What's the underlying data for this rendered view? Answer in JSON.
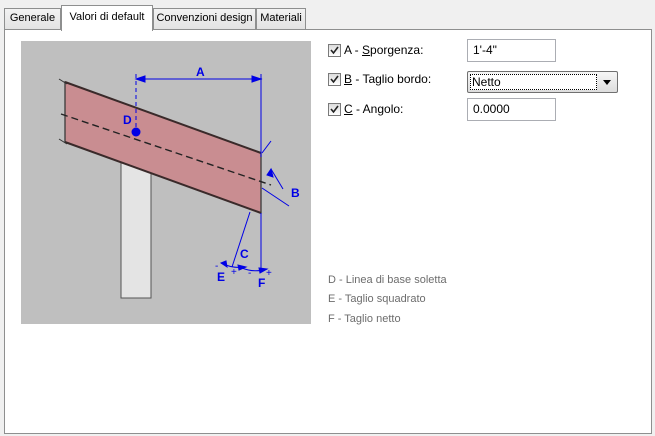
{
  "tabs": [
    {
      "label": "Generale"
    },
    {
      "label": "Valori di default"
    },
    {
      "label": "Convenzioni design"
    },
    {
      "label": "Materiali"
    }
  ],
  "active_tab": "Valori di default",
  "diagram": {
    "labels": {
      "a": "A",
      "b": "B",
      "c": "C",
      "d": "D",
      "e": "E",
      "f": "F",
      "plus": "+",
      "minus": "-"
    }
  },
  "fields": {
    "sporgenza": {
      "label_prefix": "A - ",
      "label_key": "S",
      "label_rest": "porgenza:",
      "checked": true,
      "value": "1'-4\""
    },
    "taglio_bordo": {
      "label_key": "B",
      "label_rest": " - Taglio bordo:",
      "checked": true,
      "value": "Netto"
    },
    "angolo": {
      "label_key": "C",
      "label_rest": " - Angolo:",
      "checked": true,
      "value": "0.0000"
    }
  },
  "legend": {
    "d": "D - Linea di base soletta",
    "e": "E - Taglio squadrato",
    "f": "F - Taglio netto"
  },
  "colors": {
    "dimension": "#0000e6",
    "slab": "#c98d91",
    "wall": "#e6e6e6",
    "figure_bg": "#bfbfbf"
  }
}
